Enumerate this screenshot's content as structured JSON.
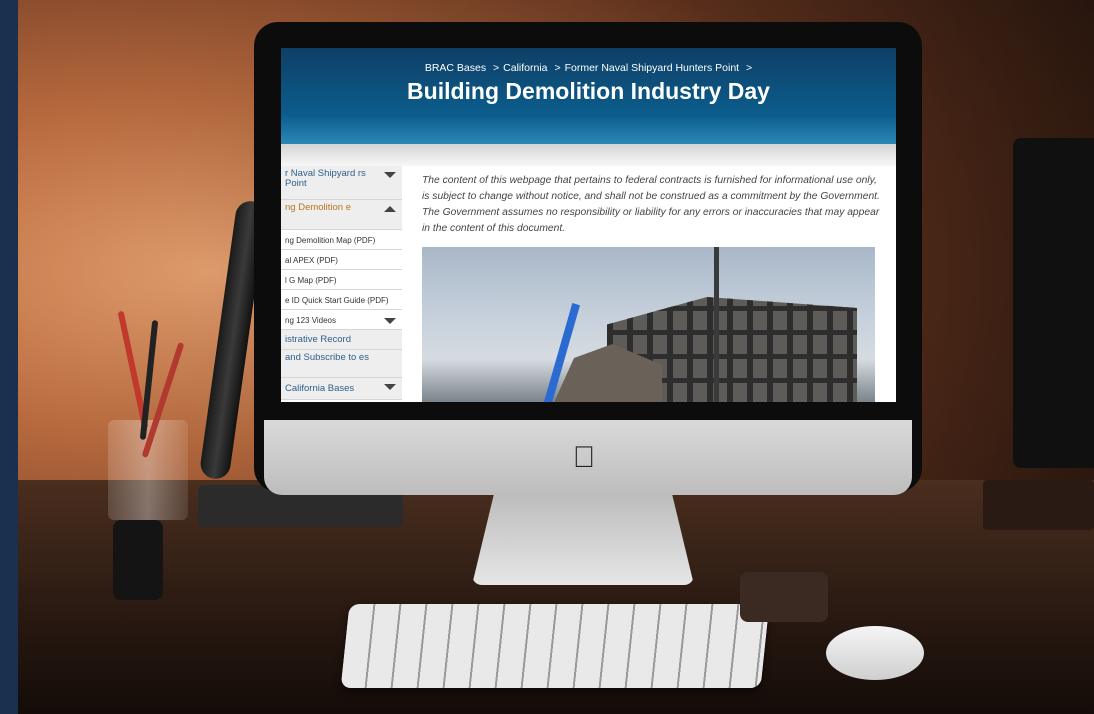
{
  "breadcrumb": {
    "item_1": "BRAC Bases",
    "item_2": "California",
    "item_3": "Former Naval Shipyard Hunters Point",
    "separator": ">"
  },
  "page": {
    "title": "Building Demolition Industry Day"
  },
  "sidebar": {
    "items": [
      {
        "label": "r Naval Shipyard rs Point"
      },
      {
        "label": "ng Demolition e"
      },
      {
        "label": "ng Demolition Map (PDF)"
      },
      {
        "label": "al APEX (PDF)"
      },
      {
        "label": "l G Map (PDF)"
      },
      {
        "label": "e ID Quick Start Guide (PDF)"
      },
      {
        "label": "ng 123 Videos"
      },
      {
        "label": "istrative Record"
      },
      {
        "label": "and Subscribe to es"
      },
      {
        "label": "California Bases"
      }
    ]
  },
  "content": {
    "disclaimer": "The content of this webpage that pertains to federal contracts is furnished for informational use only, is subject to change without notice, and shall not be construed as a commitment by the Government. The Government assumes no responsibility or liability for any errors or inaccuracies that may appear in the content of this document."
  },
  "colors": {
    "hero": "#0b5d8c",
    "link": "#2e5f8a",
    "active": "#b3761f",
    "frame": "#1b2f4f"
  },
  "icons": {
    "expand": "chevron-down-icon",
    "collapse": "chevron-up-icon",
    "brand": "apple-logo-icon"
  }
}
